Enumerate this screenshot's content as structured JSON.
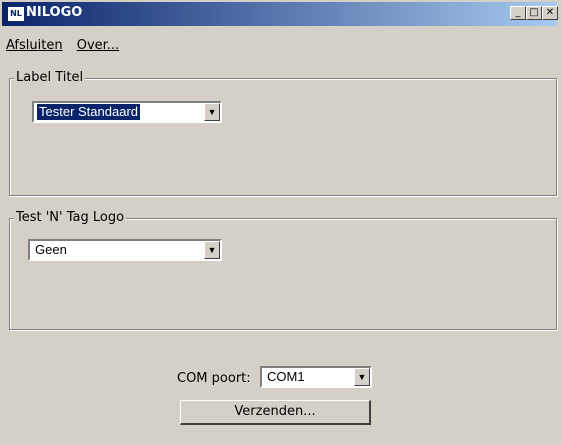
{
  "window": {
    "title": "NILOGO",
    "icon": "NL"
  },
  "controls": {
    "minimize": "_",
    "maximize": "□",
    "close": "✕"
  },
  "menu": {
    "items": [
      "Afsluiten",
      "Over..."
    ]
  },
  "group1": {
    "legend": "Label Titel",
    "combo_value": "Tester Standaard"
  },
  "group2": {
    "legend": "Test 'N' Tag Logo",
    "combo_value": "Geen"
  },
  "com": {
    "label": "COM poort:",
    "value": "COM1"
  },
  "send_button": {
    "label": "Verzenden..."
  },
  "icons": {
    "dropdown": "▼"
  }
}
